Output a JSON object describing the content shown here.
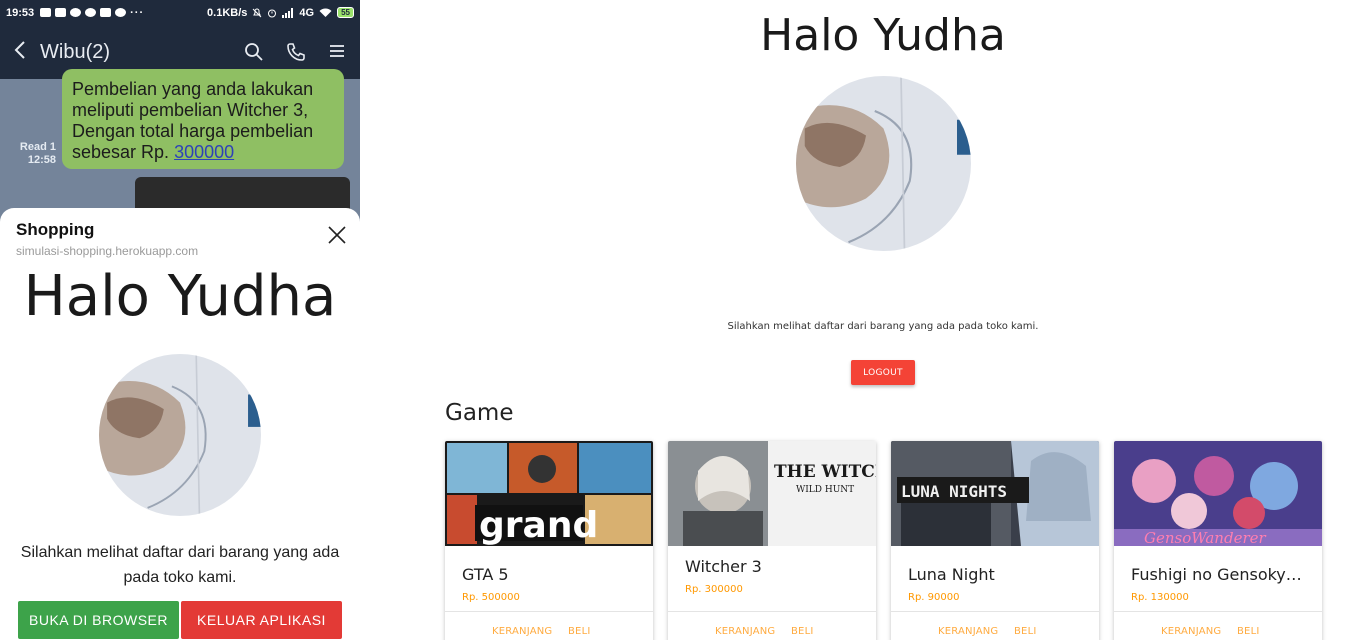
{
  "statusbar": {
    "time": "19:53",
    "dots": "···",
    "speed": "0.1KB/s",
    "network": "4G",
    "battery": "55"
  },
  "chat": {
    "title": "Wibu(2)",
    "read_label": "Read 1",
    "read_time": "12:58",
    "message_text": "Pembelian yang anda lakukan meliputi pembelian Witcher 3, Dengan total harga pembelian sebesar Rp.",
    "message_link": "300000"
  },
  "sheet": {
    "title": "Shopping",
    "url": "simulasi-shopping.herokuapp.com",
    "heading": "Halo Yudha",
    "text": "Silahkan melihat daftar dari barang yang ada pada toko kami.",
    "open_browser_label": "BUKA DI BROWSER",
    "exit_app_label": "KELUAR APLIKASI"
  },
  "page": {
    "heading": "Halo Yudha",
    "text": "Silahkan melihat daftar dari barang yang ada pada toko kami.",
    "logout_label": "LOGOUT",
    "section_title": "Game"
  },
  "products": [
    {
      "name": "GTA 5",
      "price": "Rp. 500000",
      "image_caption": "grand",
      "cart_label": "KERANJANG",
      "buy_label": "BELI"
    },
    {
      "name": "Witcher 3",
      "price": "Rp. 300000",
      "image_caption": "THE WITCHER",
      "image_subcaption": "WILD HUNT",
      "cart_label": "KERANJANG",
      "buy_label": "BELI"
    },
    {
      "name": "Luna Night",
      "price": "Rp. 90000",
      "image_caption": "LUNA NIGHTS",
      "cart_label": "KERANJANG",
      "buy_label": "BELI"
    },
    {
      "name": "Fushigi no Gensokyo...",
      "price": "Rp. 130000",
      "image_caption": "GensoWanderer",
      "cart_label": "KERANJANG",
      "buy_label": "BELI"
    }
  ],
  "colors": {
    "chat_header": "#1f2a3c",
    "bubble": "#8fbf63",
    "green_button": "#3da34a",
    "red_button": "#e33a36",
    "logout_button": "#f44336",
    "price": "#ff9800",
    "card_action": "#ffab40"
  }
}
